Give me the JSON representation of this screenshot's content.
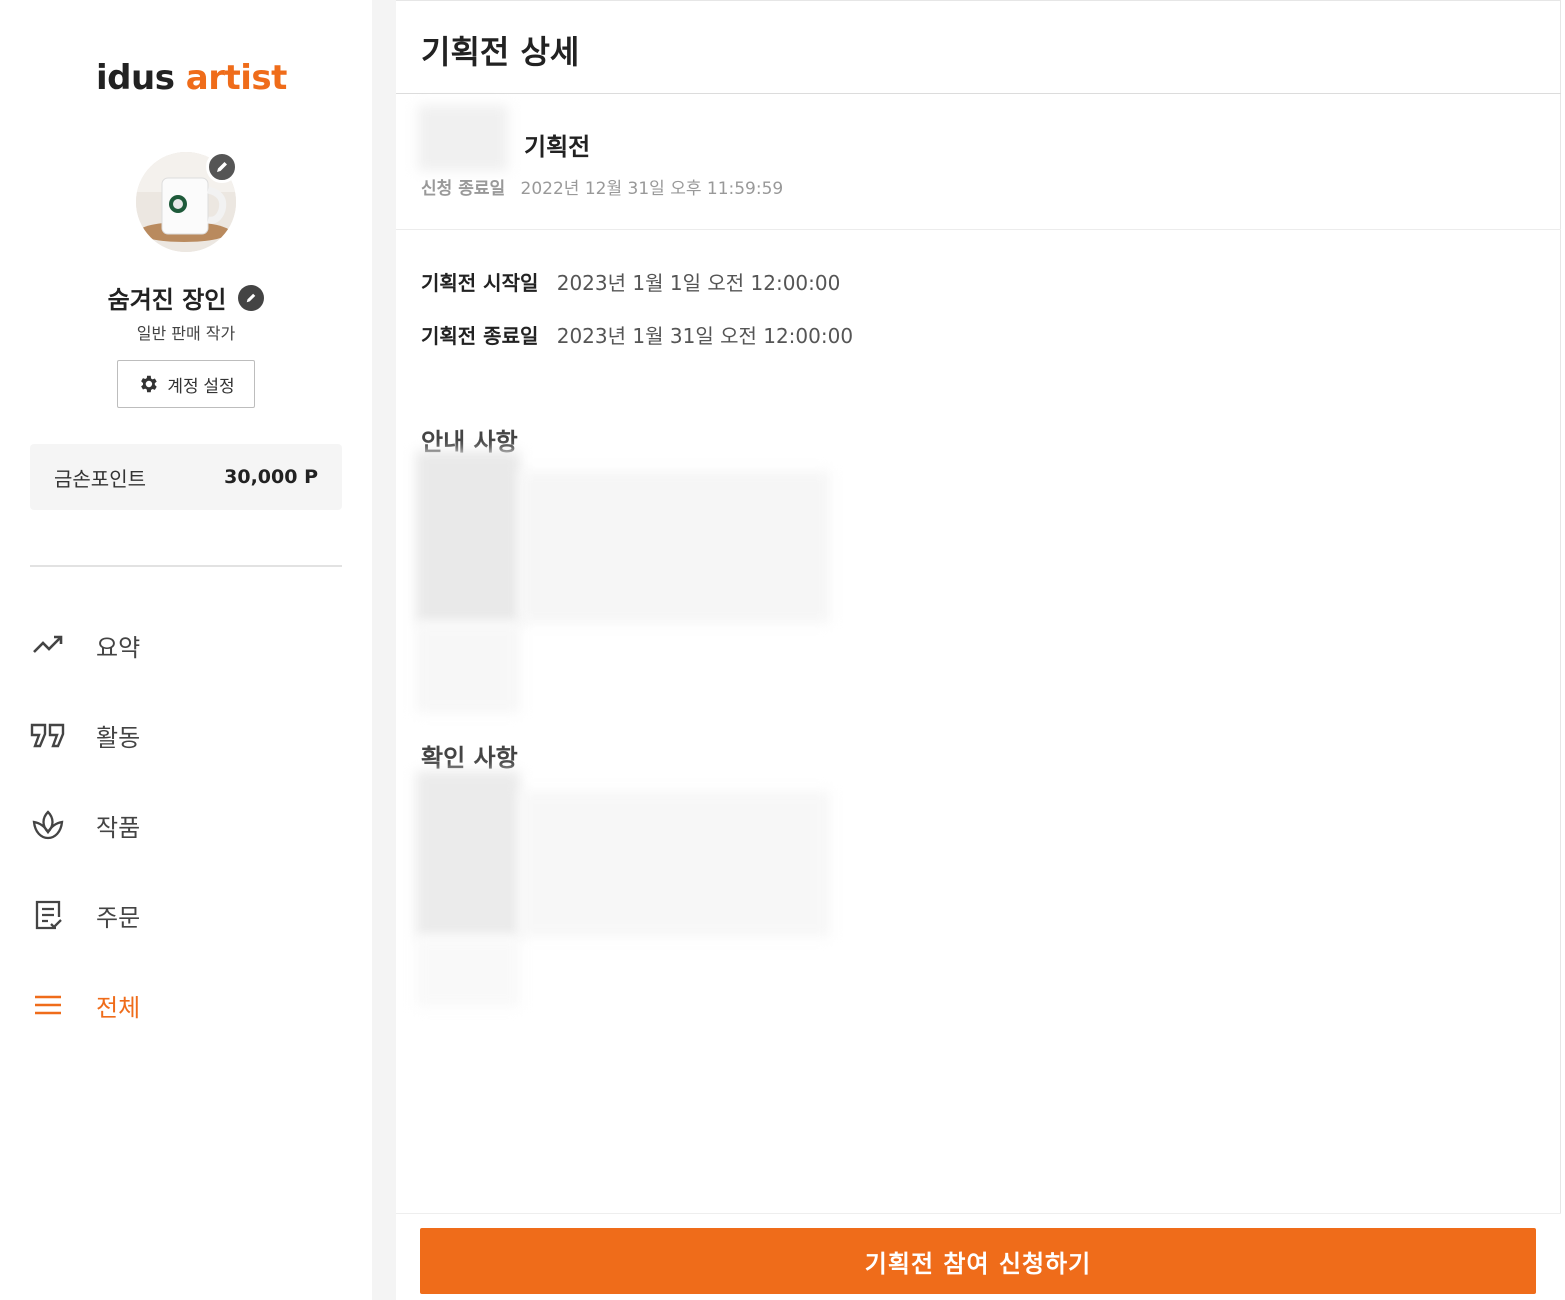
{
  "sidebar": {
    "logo_left": "idus",
    "logo_right": "artist",
    "profile": {
      "nickname": "숨겨진 장인",
      "grade": "일반 판매 작가"
    },
    "account_button": "계정 설정",
    "points": {
      "label": "금손포인트",
      "value": "30,000 P"
    },
    "nav": [
      {
        "label": "요약",
        "icon": "trend-icon"
      },
      {
        "label": "활동",
        "icon": "quote-icon"
      },
      {
        "label": "작품",
        "icon": "plant-icon"
      },
      {
        "label": "주문",
        "icon": "order-list-icon"
      },
      {
        "label": "전체",
        "icon": "menu-icon",
        "active": true
      }
    ]
  },
  "main": {
    "title": "기획전 상세",
    "event_name": "기획전",
    "deadline": {
      "label": "신청 종료일",
      "value": "2022년 12월 31일 오후 11:59:59"
    },
    "period": [
      {
        "label": "기획전 시작일",
        "value": "2023년 1월 1일 오전 12:00:00"
      },
      {
        "label": "기획전 종료일",
        "value": "2023년 1월 31일 오전 12:00:00"
      }
    ],
    "notice_title": "안내 사항",
    "confirm_title": "확인 사항",
    "apply_button": "기획전 참여 신청하기"
  },
  "colors": {
    "accent": "#ef6c1a",
    "text": "#222222",
    "muted": "#999999"
  }
}
